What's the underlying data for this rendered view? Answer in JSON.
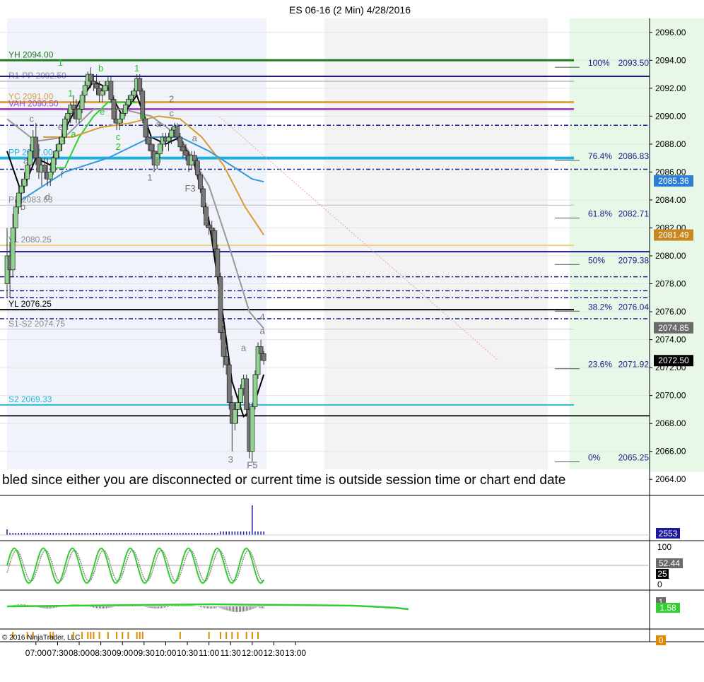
{
  "chart_data": {
    "type": "candlestick",
    "title": "ES 06-16 (2 Min)  4/28/2016",
    "symbol": "ES 06-16",
    "interval": "2 Min",
    "date": "4/28/2016",
    "ylim": [
      2063,
      2097
    ],
    "y_ticks": [
      "2064.00",
      "2066.00",
      "2068.00",
      "2070.00",
      "2072.00",
      "2074.00",
      "2076.00",
      "2078.00",
      "2080.00",
      "2082.00",
      "2084.00",
      "2086.00",
      "2088.00",
      "2090.00",
      "2092.00",
      "2094.00",
      "2096.00"
    ],
    "x_ticks": [
      "07:00",
      "07:30",
      "08:00",
      "08:30",
      "09:00",
      "09:30",
      "10:00",
      "10:30",
      "11:00",
      "11:30",
      "12:00",
      "12:30",
      "13:00"
    ],
    "x_range_minutes": [
      400,
      796
    ],
    "shading": [
      {
        "from": 400,
        "to": 580,
        "color": "#f1f3fb"
      },
      {
        "from": 620,
        "to": 775,
        "color": "#f3f3f3"
      },
      {
        "from": 790,
        "to": 910,
        "color": "#e8f8e8"
      }
    ],
    "levels": [
      {
        "label": "YH 2094.00",
        "price": 2094.0,
        "color": "#1f7a1f",
        "width": 3
      },
      {
        "label": "R1-PP 2092.50",
        "price": 2092.5,
        "color": "#999999",
        "width": 1
      },
      {
        "label": "YC 2091.00",
        "price": 2091.0,
        "color": "#d9a340",
        "width": 3
      },
      {
        "label": "VAH 2090.50",
        "price": 2090.5,
        "color": "#a64cc7",
        "width": 3
      },
      {
        "label": "PP 2087.00",
        "price": 2087.0,
        "color": "#1fb0e0",
        "width": 4
      },
      {
        "label": "PP 2083.63",
        "price": 2083.63,
        "color": "#bbbbbb",
        "width": 1
      },
      {
        "label": "VL 2080.25",
        "price": 2080.75,
        "color": "#f0d080",
        "width": 2
      },
      {
        "label": "YL 2076.25",
        "price": 2076.15,
        "color": "#000000",
        "width": 2
      },
      {
        "label": "S1-S2 2074.75",
        "price": 2074.75,
        "color": "#cccccc",
        "width": 1
      },
      {
        "label": "S2 2069.33",
        "price": 2069.33,
        "color": "#29b8d8",
        "width": 2
      }
    ],
    "fib_levels": [
      {
        "label": "100%",
        "price": 2093.5
      },
      {
        "label": "76.4%",
        "price": 2086.83
      },
      {
        "label": "61.8%",
        "price": 2082.71
      },
      {
        "label": "50%",
        "price": 2079.38
      },
      {
        "label": "38.2%",
        "price": 2076.04
      },
      {
        "label": "23.6%",
        "price": 2071.92
      },
      {
        "label": "0%",
        "price": 2065.25
      }
    ],
    "price_badges": [
      {
        "value": "2085.36",
        "color": "#2a7fd4"
      },
      {
        "value": "2081.49",
        "color": "#c9881d"
      },
      {
        "value": "2074.85",
        "color": "#6b6b6b"
      },
      {
        "value": "2072.50",
        "color": "#000000"
      }
    ],
    "candles": [
      [
        400,
        2078,
        2082,
        2077,
        2080
      ],
      [
        402,
        2080,
        2081,
        2077,
        2079
      ],
      [
        404,
        2079,
        2083,
        2078.5,
        2082
      ],
      [
        406,
        2082,
        2084,
        2081,
        2083.5
      ],
      [
        408,
        2083.5,
        2085,
        2083,
        2084.5
      ],
      [
        410,
        2084.5,
        2085.5,
        2083.5,
        2085
      ],
      [
        412,
        2085,
        2086,
        2084.5,
        2085.5
      ],
      [
        414,
        2085.5,
        2087,
        2085,
        2086.5
      ],
      [
        416,
        2086.5,
        2088,
        2086,
        2087.5
      ],
      [
        418,
        2087.5,
        2089,
        2087,
        2088.5
      ],
      [
        420,
        2088.5,
        2089.5,
        2086.5,
        2087
      ],
      [
        422,
        2087,
        2088,
        2085.5,
        2086
      ],
      [
        424,
        2086,
        2087,
        2085,
        2086.5
      ],
      [
        426,
        2086.5,
        2087,
        2085.5,
        2086
      ],
      [
        428,
        2086,
        2087,
        2085,
        2085.5
      ],
      [
        430,
        2085.5,
        2086.5,
        2085,
        2086
      ],
      [
        432,
        2086,
        2087.5,
        2085.8,
        2087
      ],
      [
        434,
        2087,
        2088,
        2086.5,
        2087.5
      ],
      [
        436,
        2087.5,
        2088.5,
        2087,
        2088
      ],
      [
        438,
        2088,
        2089,
        2087.5,
        2088.5
      ],
      [
        440,
        2088.5,
        2090,
        2088,
        2089.8
      ],
      [
        442,
        2089.8,
        2090.5,
        2089,
        2090.2
      ],
      [
        444,
        2090.2,
        2091,
        2089.5,
        2090.8
      ],
      [
        446,
        2090.8,
        2091.5,
        2089.8,
        2090.5
      ],
      [
        448,
        2090.5,
        2091.2,
        2089.5,
        2089.8
      ],
      [
        450,
        2089.8,
        2090.8,
        2089.5,
        2090.5
      ],
      [
        452,
        2090.5,
        2091.8,
        2090.2,
        2091.5
      ],
      [
        454,
        2091.5,
        2092.5,
        2091,
        2092.2
      ],
      [
        456,
        2092.2,
        2093.2,
        2091.8,
        2093
      ],
      [
        458,
        2093,
        2093.5,
        2092,
        2092.5
      ],
      [
        460,
        2092.5,
        2093,
        2091.8,
        2092.3
      ],
      [
        462,
        2092.3,
        2093,
        2091.5,
        2092
      ],
      [
        464,
        2092,
        2092.5,
        2091,
        2091.5
      ],
      [
        466,
        2091.5,
        2092.2,
        2091,
        2091.8
      ],
      [
        468,
        2091.8,
        2092.5,
        2091.5,
        2092.2
      ],
      [
        470,
        2092.2,
        2092.8,
        2091.8,
        2092.5
      ],
      [
        472,
        2092.5,
        2092.8,
        2091,
        2091.2
      ],
      [
        474,
        2091.2,
        2091.5,
        2089.5,
        2089.8
      ],
      [
        476,
        2089.8,
        2090.5,
        2089,
        2089.5
      ],
      [
        478,
        2089.5,
        2090.2,
        2089,
        2089.8
      ],
      [
        480,
        2089.8,
        2090.5,
        2089.5,
        2090.2
      ],
      [
        482,
        2090.2,
        2091,
        2090,
        2090.8
      ],
      [
        484,
        2090.8,
        2091.5,
        2090.5,
        2091.2
      ],
      [
        486,
        2091.2,
        2091.8,
        2090.8,
        2091.5
      ],
      [
        488,
        2091.5,
        2092,
        2091,
        2091.8
      ],
      [
        490,
        2091.8,
        2093,
        2091.5,
        2092.7
      ],
      [
        492,
        2092.7,
        2093,
        2091.5,
        2091.8
      ],
      [
        494,
        2091.8,
        2092,
        2089.5,
        2089.8
      ],
      [
        496,
        2089.8,
        2090,
        2088,
        2088.5
      ],
      [
        498,
        2088.5,
        2089,
        2087.5,
        2088
      ],
      [
        500,
        2088,
        2088.5,
        2087,
        2087.5
      ],
      [
        502,
        2087.5,
        2088,
        2086,
        2086.5
      ],
      [
        504,
        2086.5,
        2087.5,
        2086.2,
        2087.3
      ],
      [
        506,
        2087.3,
        2088.2,
        2087,
        2088
      ],
      [
        508,
        2088,
        2088.8,
        2087.5,
        2088.5
      ],
      [
        510,
        2088.5,
        2088.8,
        2087.8,
        2088.2
      ],
      [
        512,
        2088.2,
        2088.8,
        2087.5,
        2088.5
      ],
      [
        514,
        2088.5,
        2089.2,
        2088,
        2089
      ],
      [
        516,
        2089,
        2089.5,
        2088.5,
        2089.3
      ],
      [
        518,
        2089.3,
        2089.5,
        2088.2,
        2088.5
      ],
      [
        520,
        2088.5,
        2088.8,
        2087.5,
        2087.8
      ],
      [
        522,
        2087.8,
        2088.2,
        2087,
        2087.5
      ],
      [
        524,
        2087.5,
        2088,
        2086.8,
        2087.2
      ],
      [
        526,
        2087.2,
        2087.5,
        2086,
        2086.5
      ],
      [
        528,
        2086.5,
        2087.5,
        2086.2,
        2087.2
      ],
      [
        530,
        2087.2,
        2087.5,
        2086.5,
        2086.8
      ],
      [
        532,
        2086.8,
        2087,
        2085.5,
        2085.8
      ],
      [
        534,
        2085.8,
        2086,
        2084.5,
        2084.8
      ],
      [
        536,
        2084.8,
        2085,
        2083,
        2083.5
      ],
      [
        538,
        2083.5,
        2083.8,
        2082,
        2082.2
      ],
      [
        540,
        2082.2,
        2082.8,
        2081.5,
        2082
      ],
      [
        542,
        2082,
        2082.5,
        2081.2,
        2081.8
      ],
      [
        544,
        2081.8,
        2082,
        2080,
        2080.5
      ],
      [
        546,
        2080.5,
        2080.8,
        2078,
        2078.5
      ],
      [
        548,
        2078.5,
        2078.8,
        2074,
        2074.5
      ],
      [
        550,
        2074.5,
        2075,
        2072,
        2072.8
      ],
      [
        552,
        2072.8,
        2073.5,
        2071.5,
        2072.2
      ],
      [
        554,
        2072.2,
        2072.5,
        2069,
        2069.5
      ],
      [
        556,
        2069.5,
        2070,
        2066,
        2068
      ],
      [
        558,
        2068,
        2069.5,
        2067.5,
        2069
      ],
      [
        560,
        2069,
        2070,
        2068,
        2069.5
      ],
      [
        562,
        2069.5,
        2070.8,
        2069,
        2070.5
      ],
      [
        564,
        2070.5,
        2071.5,
        2070,
        2071.2
      ],
      [
        566,
        2071.2,
        2071.5,
        2068.5,
        2069
      ],
      [
        568,
        2069,
        2069.5,
        2065.5,
        2066
      ],
      [
        570,
        2066,
        2069.5,
        2065.2,
        2069.2
      ],
      [
        572,
        2069.2,
        2071.8,
        2069,
        2071.5
      ],
      [
        574,
        2071.5,
        2073.8,
        2071.2,
        2073.5
      ],
      [
        576,
        2073.5,
        2074,
        2072.5,
        2073
      ],
      [
        578,
        2073,
        2073.2,
        2072.2,
        2072.5
      ]
    ],
    "series": [
      {
        "name": "fast",
        "color": "#000000",
        "points": [
          [
            400,
            2087.5
          ],
          [
            410,
            2084.5
          ],
          [
            420,
            2087
          ],
          [
            430,
            2086.5
          ],
          [
            440,
            2089
          ],
          [
            450,
            2091
          ],
          [
            460,
            2092.5
          ],
          [
            470,
            2092
          ],
          [
            480,
            2090
          ],
          [
            490,
            2091.5
          ],
          [
            500,
            2088.5
          ],
          [
            510,
            2088
          ],
          [
            520,
            2088.5
          ],
          [
            530,
            2086.5
          ],
          [
            540,
            2082.5
          ],
          [
            548,
            2077
          ],
          [
            556,
            2071
          ],
          [
            564,
            2068.5
          ],
          [
            570,
            2069
          ],
          [
            578,
            2071.5
          ]
        ]
      },
      {
        "name": "green",
        "color": "#33cc33",
        "points": [
          [
            430,
            2086.3
          ],
          [
            440,
            2086.3
          ],
          [
            450,
            2088.5
          ],
          [
            460,
            2090
          ],
          [
            470,
            2091
          ],
          [
            480,
            2091
          ],
          [
            490,
            2091
          ]
        ]
      },
      {
        "name": "grey",
        "color": "#999999",
        "points": [
          [
            400,
            2089.8
          ],
          [
            420,
            2088.2
          ],
          [
            440,
            2088.5
          ],
          [
            460,
            2090.5
          ],
          [
            480,
            2090.5
          ],
          [
            500,
            2090
          ],
          [
            520,
            2088.5
          ],
          [
            540,
            2085
          ],
          [
            556,
            2080
          ],
          [
            568,
            2076
          ],
          [
            578,
            2074.8
          ]
        ]
      },
      {
        "name": "orange",
        "color": "#d99a30",
        "points": [
          [
            425,
            2088.5
          ],
          [
            445,
            2088.5
          ],
          [
            465,
            2089.2
          ],
          [
            485,
            2089.5
          ],
          [
            505,
            2090
          ],
          [
            520,
            2089.8
          ],
          [
            535,
            2088.5
          ],
          [
            550,
            2086.5
          ],
          [
            565,
            2083.5
          ],
          [
            578,
            2081.5
          ]
        ]
      },
      {
        "name": "blue",
        "color": "#3399dd",
        "points": [
          [
            410,
            2084
          ],
          [
            440,
            2086
          ],
          [
            470,
            2087
          ],
          [
            500,
            2088.5
          ],
          [
            520,
            2088.5
          ],
          [
            540,
            2087.5
          ],
          [
            558,
            2086.3
          ],
          [
            570,
            2085.5
          ],
          [
            578,
            2085.3
          ]
        ]
      }
    ],
    "volume_badge": "2553",
    "oscillator_ticks": [
      "100",
      "50",
      "0"
    ],
    "oscillator_badges": [
      "52.44",
      "25"
    ],
    "macd_badges": [
      "1",
      "1.58"
    ],
    "bottom_badge": "0"
  },
  "banner": "bled since either you are disconnected or current time is outside session time or chart end date",
  "copyright": "© 2016 NinjaTrader, LLC",
  "wave_labels": [
    {
      "text": "1",
      "t": 437,
      "p": 2093.6,
      "color": "#22c422"
    },
    {
      "text": "b",
      "t": 465,
      "p": 2093.2,
      "color": "#22c422"
    },
    {
      "text": "1",
      "t": 490,
      "p": 2093.2,
      "color": "#22c422"
    },
    {
      "text": "1",
      "t": 444,
      "p": 2091.4,
      "color": "#22c422"
    },
    {
      "text": "e",
      "t": 466,
      "p": 2090.1,
      "color": "#22c422"
    },
    {
      "text": "a",
      "t": 446,
      "p": 2088.5,
      "color": "#22c422"
    },
    {
      "text": "c",
      "t": 477,
      "p": 2088.3,
      "color": "#22c422"
    },
    {
      "text": "2",
      "t": 477,
      "p": 2087.6,
      "color": "#22c422"
    },
    {
      "text": "a",
      "t": 494,
      "p": 2089.8,
      "color": "#22c422"
    },
    {
      "text": "c",
      "t": 417,
      "p": 2089.6,
      "color": "#777777"
    },
    {
      "text": "e",
      "t": 437,
      "p": 2089.0,
      "color": "#777777"
    },
    {
      "text": "a",
      "t": 413,
      "p": 2086.6,
      "color": "#777777"
    },
    {
      "text": "f",
      "t": 438,
      "p": 2085.6,
      "color": "#777777"
    },
    {
      "text": "d",
      "t": 428,
      "p": 2084.0,
      "color": "#777777"
    },
    {
      "text": "b",
      "t": 411,
      "p": 2083.3,
      "color": "#777777"
    },
    {
      "text": "2",
      "t": 514,
      "p": 2091.0,
      "color": "#777777"
    },
    {
      "text": "c",
      "t": 514,
      "p": 2090.0,
      "color": "#777777"
    },
    {
      "text": "a",
      "t": 505,
      "p": 2089.2,
      "color": "#777777"
    },
    {
      "text": "b",
      "t": 505,
      "p": 2086.6,
      "color": "#777777"
    },
    {
      "text": "1",
      "t": 499,
      "p": 2085.4,
      "color": "#777777"
    },
    {
      "text": "a",
      "t": 530,
      "p": 2088.2,
      "color": "#777777"
    },
    {
      "text": "F3",
      "t": 527,
      "p": 2084.6,
      "color": "#777777"
    },
    {
      "text": "a",
      "t": 564,
      "p": 2073.2,
      "color": "#777777"
    },
    {
      "text": "4",
      "t": 577,
      "p": 2075.4,
      "color": "#777777"
    },
    {
      "text": "a",
      "t": 577,
      "p": 2074.4,
      "color": "#777777"
    },
    {
      "text": "3",
      "t": 555,
      "p": 2065.2,
      "color": "#777777"
    },
    {
      "text": "F5",
      "t": 570,
      "p": 2064.8,
      "color": "#777777"
    }
  ]
}
